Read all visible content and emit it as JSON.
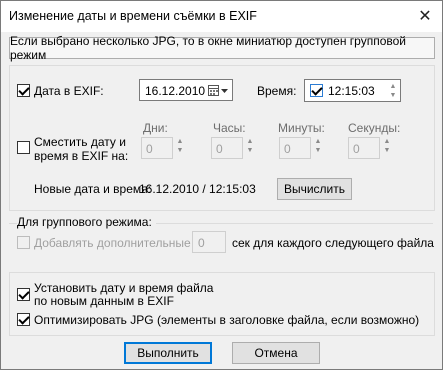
{
  "window": {
    "title": "Изменение даты и времени съёмки в EXIF",
    "close_glyph": "✕"
  },
  "info_text": "Если выбрано несколько JPG, то в окне миниатюр доступен групповой режим",
  "date_section": {
    "date_label": "Дата в EXIF:",
    "date_value": "16.12.2010",
    "time_label": "Время:",
    "time_value": "12:15:03",
    "shift_label_line1": "Сместить дату и",
    "shift_label_line2": "время в EXIF на:",
    "days_label": "Дни:",
    "hours_label": "Часы:",
    "minutes_label": "Минуты:",
    "seconds_label": "Секунды:",
    "days_value": "0",
    "hours_value": "0",
    "minutes_value": "0",
    "seconds_value": "0",
    "new_label": "Новые дата и время:",
    "new_value": "16.12.2010 / 12:15:03",
    "calc_button": "Вычислить"
  },
  "group_section": {
    "title": "Для группового режима:",
    "add_label": "Добавлять дополнительные",
    "add_value": "0",
    "suffix": "сек для каждого следующего файла"
  },
  "options": {
    "set_file_date_line1": "Установить дату и время файла",
    "set_file_date_line2": "по новым данным в EXIF",
    "optimize_jpg": "Оптимизировать JPG (элементы в заголовке файла, если возможно)"
  },
  "buttons": {
    "ok": "Выполнить",
    "cancel": "Отмена"
  },
  "state": {
    "date_checked": true,
    "time_checked": true,
    "shift_checked": false,
    "add_checked": false,
    "set_file_date_checked": true,
    "optimize_checked": true
  }
}
